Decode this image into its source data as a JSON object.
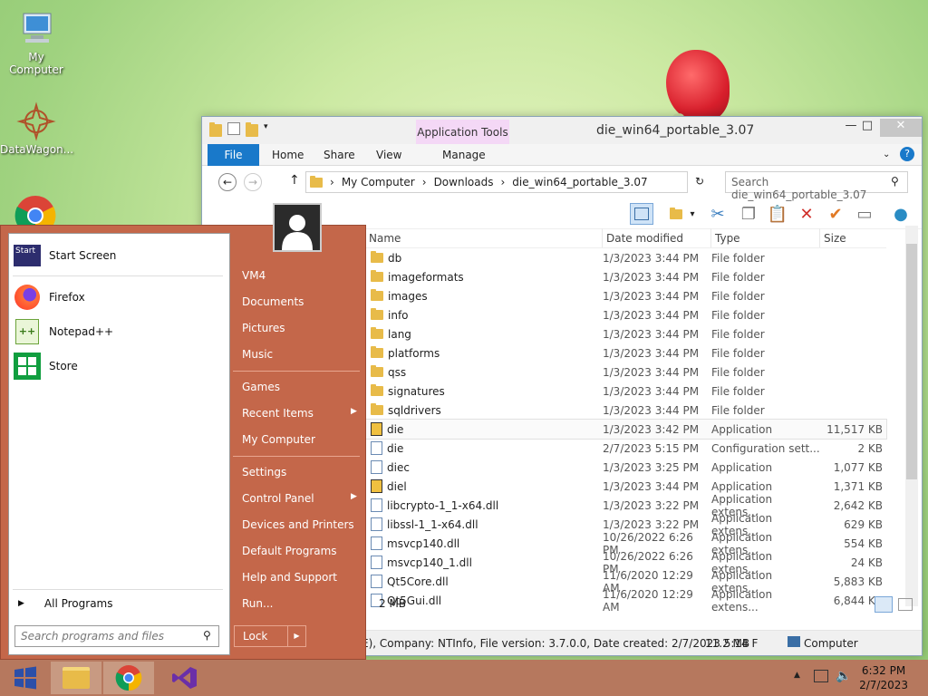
{
  "desktop": {
    "icons": [
      {
        "label": "My Computer"
      },
      {
        "label": "DataWagon..."
      }
    ]
  },
  "explorer": {
    "title": "die_win64_portable_3.07",
    "app_tools": "Application Tools",
    "tabs": [
      "File",
      "Home",
      "Share",
      "View",
      "Manage"
    ],
    "breadcrumb": [
      "My Computer",
      "Downloads",
      "die_win64_portable_3.07"
    ],
    "search_placeholder": "Search die_win64_portable_3.07",
    "columns": [
      "Name",
      "Date modified",
      "Type",
      "Size"
    ],
    "rows": [
      {
        "name": "db",
        "date": "1/3/2023 3:44 PM",
        "type": "File folder",
        "size": "",
        "kind": "folder"
      },
      {
        "name": "imageformats",
        "date": "1/3/2023 3:44 PM",
        "type": "File folder",
        "size": "",
        "kind": "folder"
      },
      {
        "name": "images",
        "date": "1/3/2023 3:44 PM",
        "type": "File folder",
        "size": "",
        "kind": "folder"
      },
      {
        "name": "info",
        "date": "1/3/2023 3:44 PM",
        "type": "File folder",
        "size": "",
        "kind": "folder"
      },
      {
        "name": "lang",
        "date": "1/3/2023 3:44 PM",
        "type": "File folder",
        "size": "",
        "kind": "folder"
      },
      {
        "name": "platforms",
        "date": "1/3/2023 3:44 PM",
        "type": "File folder",
        "size": "",
        "kind": "folder"
      },
      {
        "name": "qss",
        "date": "1/3/2023 3:44 PM",
        "type": "File folder",
        "size": "",
        "kind": "folder"
      },
      {
        "name": "signatures",
        "date": "1/3/2023 3:44 PM",
        "type": "File folder",
        "size": "",
        "kind": "folder"
      },
      {
        "name": "sqldrivers",
        "date": "1/3/2023 3:44 PM",
        "type": "File folder",
        "size": "",
        "kind": "folder"
      },
      {
        "name": "die",
        "date": "1/3/2023 3:42 PM",
        "type": "Application",
        "size": "11,517 KB",
        "kind": "app",
        "selected": true
      },
      {
        "name": "die",
        "date": "2/7/2023 5:15 PM",
        "type": "Configuration sett...",
        "size": "2 KB",
        "kind": "file"
      },
      {
        "name": "diec",
        "date": "1/3/2023 3:25 PM",
        "type": "Application",
        "size": "1,077 KB",
        "kind": "file"
      },
      {
        "name": "diel",
        "date": "1/3/2023 3:44 PM",
        "type": "Application",
        "size": "1,371 KB",
        "kind": "app"
      },
      {
        "name": "libcrypto-1_1-x64.dll",
        "date": "1/3/2023 3:22 PM",
        "type": "Application extens...",
        "size": "2,642 KB",
        "kind": "file"
      },
      {
        "name": "libssl-1_1-x64.dll",
        "date": "1/3/2023 3:22 PM",
        "type": "Application extens...",
        "size": "629 KB",
        "kind": "file"
      },
      {
        "name": "msvcp140.dll",
        "date": "10/26/2022 6:26 PM",
        "type": "Application extens...",
        "size": "554 KB",
        "kind": "file"
      },
      {
        "name": "msvcp140_1.dll",
        "date": "10/26/2022 6:26 PM",
        "type": "Application extens...",
        "size": "24 KB",
        "kind": "file"
      },
      {
        "name": "Qt5Core.dll",
        "date": "11/6/2020 12:29 AM",
        "type": "Application extens...",
        "size": "5,883 KB",
        "kind": "file"
      },
      {
        "name": "Qt5Gui.dll",
        "date": "11/6/2020 12:29 AM",
        "type": "Application extens...",
        "size": "6,844 KB",
        "kind": "file"
      }
    ],
    "status_size": "2 MB",
    "status_details": "E), Company: NTInfo, File version: 3.7.0.0, Date created: 2/7/2023 5:14 F",
    "status_total": "11.2 MB",
    "status_location": "Computer"
  },
  "start_menu": {
    "pinned": [
      "Start Screen",
      "Firefox",
      "Notepad++",
      "Store"
    ],
    "all_programs": "All Programs",
    "search_placeholder": "Search programs and files",
    "right_items": [
      "VM4",
      "Documents",
      "Pictures",
      "Music",
      "Games",
      "Recent Items",
      "My Computer",
      "Settings",
      "Control Panel",
      "Devices and Printers",
      "Default Programs",
      "Help and Support",
      "Run..."
    ],
    "lock": "Lock",
    "start_icon_label": "Start"
  },
  "taskbar": {
    "time": "6:32 PM",
    "date": "2/7/2023"
  }
}
